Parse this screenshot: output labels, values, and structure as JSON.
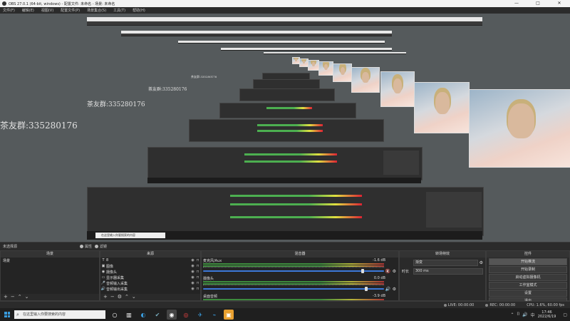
{
  "window": {
    "title": "OBS 27.0.1 (64-bit, windows) - 配置文件: 未命名 - 场景: 未命名",
    "controls": [
      "—",
      "□",
      "✕"
    ]
  },
  "menu": [
    "文件(F)",
    "编辑(E)",
    "视图(V)",
    "配置文件(P)",
    "场景集合(S)",
    "工具(T)",
    "帮助(H)"
  ],
  "preview": {
    "watermark": "茶友群:335280176"
  },
  "source_toolbar": {
    "label": "未选择源",
    "properties": "属性",
    "filters": "滤镜"
  },
  "docks": {
    "scenes": {
      "title": "场景",
      "items": [
        "场景"
      ]
    },
    "sources": {
      "title": "来源",
      "items": [
        {
          "icon": "text-icon",
          "glyph": "T",
          "name": "8"
        },
        {
          "icon": "image-icon",
          "glyph": "▣",
          "name": "图像"
        },
        {
          "icon": "camera-icon",
          "glyph": "◉",
          "name": "摄像头"
        },
        {
          "icon": "display-capture-icon",
          "glyph": "▭",
          "name": "显示器采集"
        },
        {
          "icon": "audio-input-icon",
          "glyph": "🎤",
          "name": "音频输入采集"
        },
        {
          "icon": "audio-output-icon",
          "glyph": "🔊",
          "name": "音频输出采集"
        }
      ]
    },
    "mixer": {
      "title": "混音器",
      "channels": [
        {
          "name": "麦克风/Aux",
          "db": "-1.6 dB",
          "muted": true,
          "level": 0.88
        },
        {
          "name": "摄像头",
          "db": "0.0 dB",
          "muted": false,
          "level": 0.9
        },
        {
          "name": "桌面音频",
          "db": "-3.9 dB",
          "muted": false,
          "level": 0.8
        }
      ]
    },
    "transitions": {
      "title": "转场特效",
      "type_label": "",
      "type_value": "渐变",
      "duration_label": "时长",
      "duration_value": "300 ms"
    },
    "controls": {
      "title": "控件",
      "buttons": [
        "开始推流",
        "开始录制",
        "启动虚拟摄像机",
        "工作室模式",
        "设置",
        "退出"
      ]
    }
  },
  "status": {
    "live": "LIVE: 00:00:00",
    "rec": "REC: 00:00:00",
    "cpu": "CPU: 1.6%, 60.00 fps"
  },
  "taskbar": {
    "search_placeholder": "在这里输入你要搜索的内容",
    "time": "17:46",
    "date": "2022/6/19",
    "tray": "中"
  },
  "colors": {
    "accent_blue": "#3c78d8",
    "meter_green": "#3d8b3d",
    "meter_yellow": "#b3b33a",
    "meter_red": "#aa3333",
    "mute_red": "#d22222"
  }
}
